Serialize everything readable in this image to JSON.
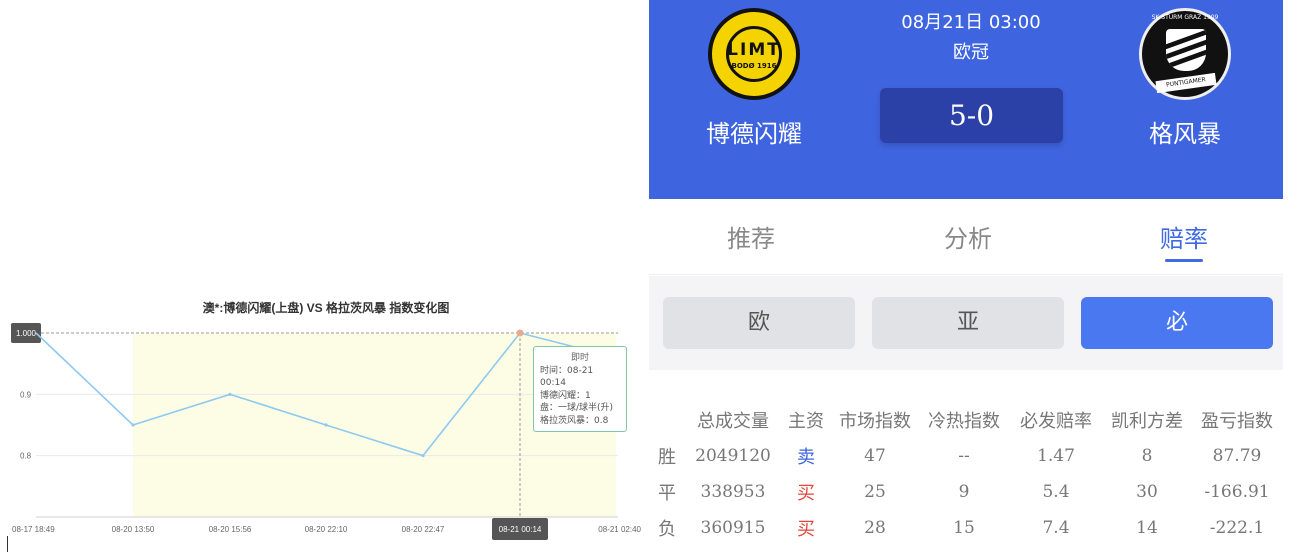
{
  "chart": {
    "title": "澳*:博德闪耀(上盘) VS 格拉茨风暴 指数变化图",
    "y_marker_label": "1.000",
    "tooltip": {
      "title": "即时",
      "time": "时间：08-21 00:14",
      "home": "博德闪耀：1",
      "handicap": "盘：一球/球半(升)",
      "away": "格拉茨风暴：0.8"
    }
  },
  "chart_data": {
    "type": "line",
    "title": "澳*:博德闪耀(上盘) VS 格拉茨风暴 指数变化图",
    "x": [
      "08-17 18:49",
      "08-20 13:50",
      "08-20 15:56",
      "08-20 22:10",
      "08-20 22:47",
      "08-21 00:14",
      "08-21 02:40"
    ],
    "series": [
      {
        "values": [
          1.0,
          0.85,
          0.9,
          0.85,
          0.8,
          1.0,
          0.96
        ]
      }
    ],
    "y_ticks": [
      "1.000",
      "0.9",
      "0.8"
    ],
    "ylim": [
      0.7,
      1.0
    ],
    "highlight_x": "08-21 00:14",
    "grid": true,
    "colors": {
      "line": "#8ec9f0",
      "band": "#fdfde6",
      "marker": "#e8a98c"
    }
  },
  "match": {
    "datetime": "08月21日 03:00",
    "league": "欧冠",
    "score": "5-0",
    "home_team": "博德闪耀",
    "away_team": "格风暴",
    "home_logo": {
      "name": "LIMT",
      "sub": "BODØ 1916"
    },
    "away_logo": {
      "ring": "SK STURM GRAZ 1909",
      "band": "PUNTIGAMER"
    }
  },
  "tabs": [
    {
      "label": "推荐"
    },
    {
      "label": "分析"
    },
    {
      "label": "赔率",
      "active": true
    }
  ],
  "subtabs": [
    {
      "label": "欧"
    },
    {
      "label": "亚"
    },
    {
      "label": "必",
      "active": true
    }
  ],
  "stats": {
    "headers": [
      "",
      "总成交量",
      "主资",
      "市场指数",
      "冷热指数",
      "必发赔率",
      "凯利方差",
      "盈亏指数"
    ],
    "rows": [
      {
        "label": "胜",
        "volume": "2049120",
        "action": "卖",
        "market": "47",
        "heat": "--",
        "odds": "1.47",
        "kelly": "8",
        "pnl": "87.79"
      },
      {
        "label": "平",
        "volume": "338953",
        "action": "买",
        "market": "25",
        "heat": "9",
        "odds": "5.4",
        "kelly": "30",
        "pnl": "-166.91"
      },
      {
        "label": "负",
        "volume": "360915",
        "action": "买",
        "market": "28",
        "heat": "15",
        "odds": "7.4",
        "kelly": "14",
        "pnl": "-222.1"
      }
    ]
  },
  "colors": {
    "header_bg": "#3f64e0",
    "score_bg": "#2c41a8",
    "active_tab": "#3f6ae0",
    "active_subtab": "#4a78f0",
    "sell": "#3d63d8",
    "buy": "#e0463a"
  }
}
